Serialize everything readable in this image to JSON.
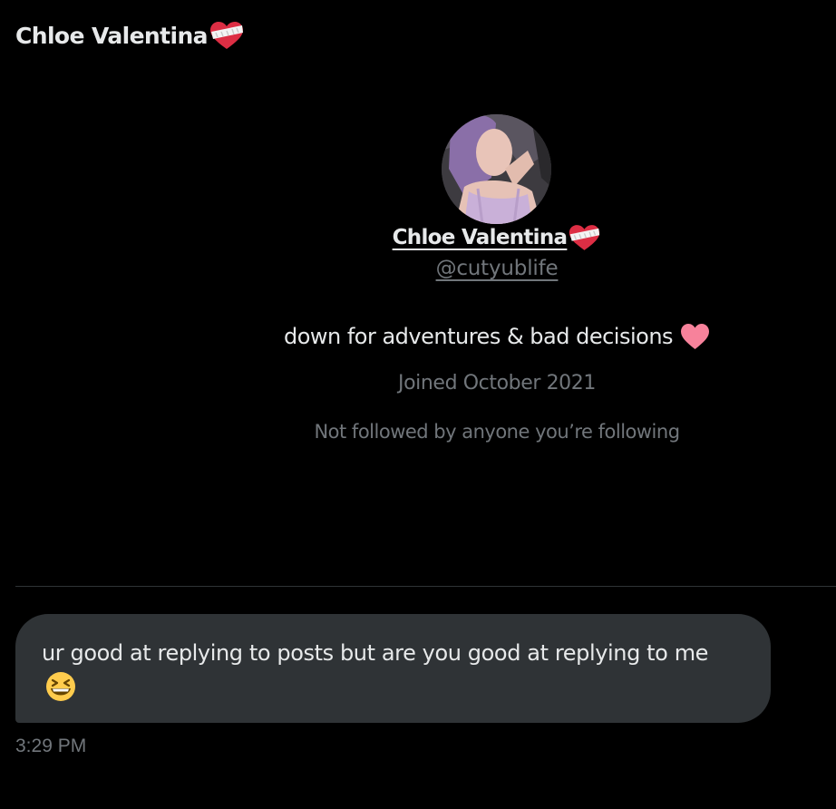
{
  "header": {
    "title": "Chloe Valentina",
    "title_emoji": "mending-heart-icon"
  },
  "profile": {
    "name": "Chloe Valentina",
    "name_emoji": "mending-heart-icon",
    "handle": "@cutyublife",
    "bio": "down for adventures & bad decisions",
    "bio_emoji": "pink-heart-icon",
    "joined": "Joined October 2021",
    "followed_by": "Not followed by anyone you’re following"
  },
  "message": {
    "text": "ur good at replying to posts but are you good at replying to me",
    "emoji": "grinning-squinting-face-icon",
    "time": "3:29 PM"
  },
  "colors": {
    "background": "#000000",
    "primary_text": "#e7e9ea",
    "secondary_text": "#71767b",
    "bubble": "#2f3336",
    "divider": "#2f3336",
    "pink_heart": "#f7829b"
  }
}
